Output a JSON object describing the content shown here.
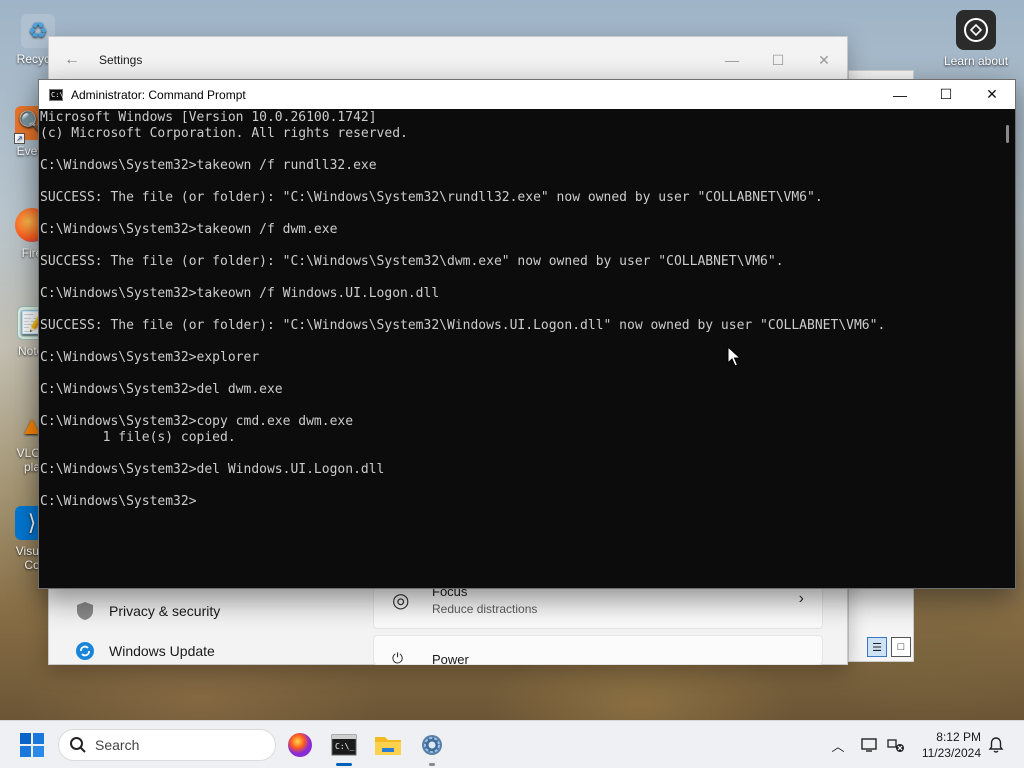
{
  "desktop": {
    "icons": [
      {
        "label": "Recycle",
        "glyph": "♻"
      },
      {
        "label": "Every",
        "glyph": "🔍"
      },
      {
        "label": "Fire",
        "glyph": "🦊"
      },
      {
        "label": "Notep",
        "glyph": "📝"
      },
      {
        "label": "VLC r",
        "label2": "pla",
        "glyph": "▲"
      },
      {
        "label": "Visual",
        "label2": "Co",
        "glyph": "⟩"
      }
    ],
    "learn_about": "Learn about"
  },
  "settings": {
    "title": "Settings",
    "back_icon": "arrow-left-icon",
    "nav": [
      {
        "label": "Privacy & security",
        "icon": "shield-icon"
      },
      {
        "label": "Windows Update",
        "icon": "update-icon"
      }
    ],
    "cards": [
      {
        "title": "Focus",
        "subtitle": "Reduce distractions",
        "icon": "focus-icon"
      },
      {
        "title": "Power",
        "icon": "power-icon"
      }
    ]
  },
  "cmd": {
    "title": "Administrator: Command Prompt",
    "lines": [
      "Microsoft Windows [Version 10.0.26100.1742]",
      "(c) Microsoft Corporation. All rights reserved.",
      "",
      "C:\\Windows\\System32>takeown /f rundll32.exe",
      "",
      "SUCCESS: The file (or folder): \"C:\\Windows\\System32\\rundll32.exe\" now owned by user \"COLLABNET\\VM6\".",
      "",
      "C:\\Windows\\System32>takeown /f dwm.exe",
      "",
      "SUCCESS: The file (or folder): \"C:\\Windows\\System32\\dwm.exe\" now owned by user \"COLLABNET\\VM6\".",
      "",
      "C:\\Windows\\System32>takeown /f Windows.UI.Logon.dll",
      "",
      "SUCCESS: The file (or folder): \"C:\\Windows\\System32\\Windows.UI.Logon.dll\" now owned by user \"COLLABNET\\VM6\".",
      "",
      "C:\\Windows\\System32>explorer",
      "",
      "C:\\Windows\\System32>del dwm.exe",
      "",
      "C:\\Windows\\System32>copy cmd.exe dwm.exe",
      "        1 file(s) copied.",
      "",
      "C:\\Windows\\System32>del Windows.UI.Logon.dll",
      "",
      "C:\\Windows\\System32>"
    ]
  },
  "taskbar": {
    "search_placeholder": "Search",
    "apps": [
      {
        "name": "firefox",
        "active": false
      },
      {
        "name": "command-prompt",
        "active": true
      },
      {
        "name": "file-explorer",
        "active": false
      },
      {
        "name": "settings",
        "active": false
      }
    ],
    "time": "8:12 PM",
    "date": "11/23/2024"
  },
  "colors": {
    "accent": "#005fb8",
    "console_bg": "#0c0c0c",
    "console_fg": "#cccccc"
  }
}
